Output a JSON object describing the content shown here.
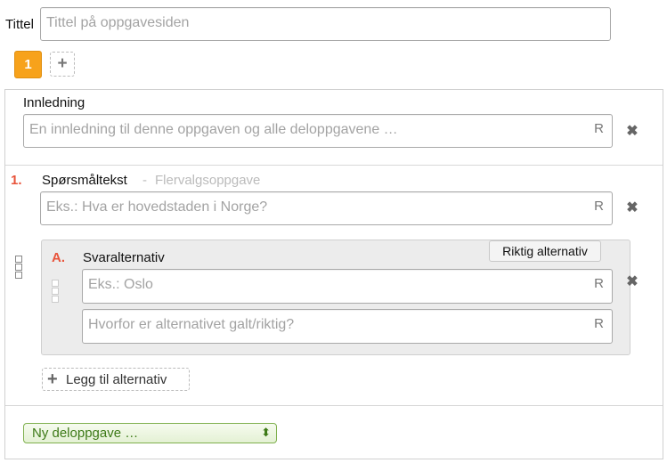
{
  "title_row": {
    "label": "Tittel",
    "placeholder": "Tittel på oppgavesiden"
  },
  "pages": {
    "tabs": [
      {
        "label": "1",
        "active": true
      }
    ],
    "add_label": "+"
  },
  "accent_color": "#f7a21b",
  "intro": {
    "label": "Innledning",
    "placeholder": "En innledning til denne oppgaven og alle deloppgavene …",
    "r_marker": "R",
    "remove_icon": "close-icon"
  },
  "subtask": {
    "number": "1.",
    "label": "Spørsmåltekst",
    "type_separator": "-",
    "type": "Flervalgsoppgave",
    "placeholder": "Eks.: Hva er hovedstaden i Norge?",
    "r_marker": "R"
  },
  "alternative": {
    "letter": "A.",
    "label": "Svaralternativ",
    "correct_button": "Riktig alternativ",
    "answer_placeholder": "Eks.: Oslo",
    "explain_placeholder": "Hvorfor er alternativet galt/riktig?",
    "r_marker": "R"
  },
  "add_alternative": {
    "icon": "+",
    "label": "Legg til alternativ"
  },
  "new_subtask_select": {
    "selected": "Ny deloppgave …",
    "arrow": "⬍",
    "color": "#4a8a1e"
  }
}
